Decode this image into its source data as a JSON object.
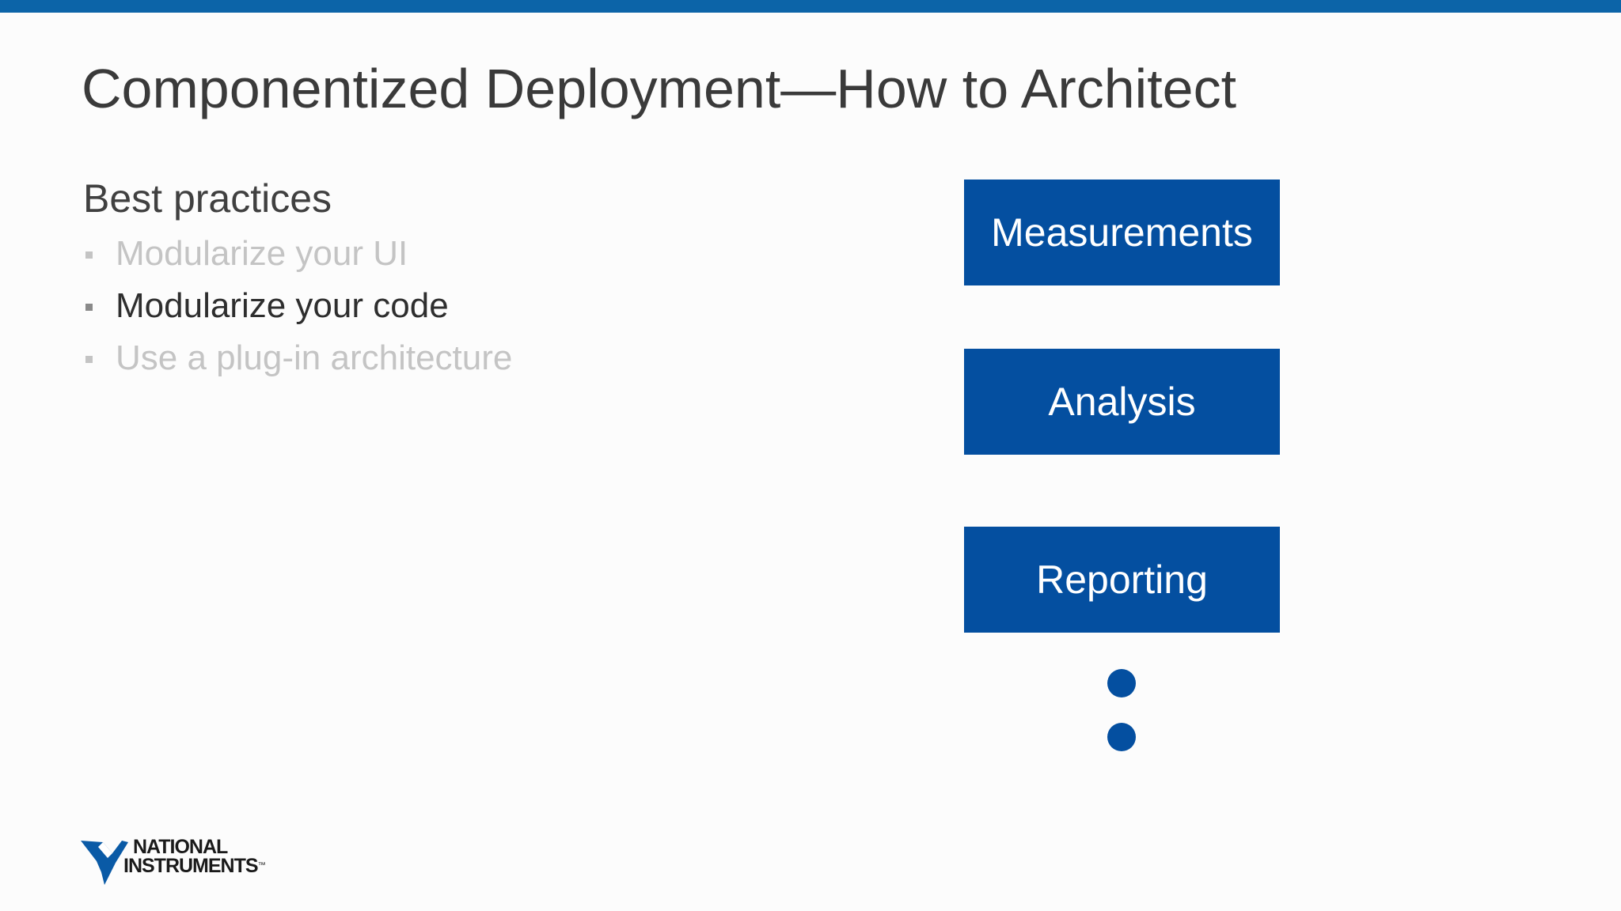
{
  "slide": {
    "title": "Componentized Deployment—How to Architect",
    "subheading": "Best practices",
    "bullets": [
      {
        "text": "Modularize your UI",
        "state": "dimmed"
      },
      {
        "text": "Modularize your code",
        "state": "active"
      },
      {
        "text": "Use a plug-in architecture",
        "state": "dimmed"
      }
    ]
  },
  "diagram": {
    "boxes": [
      "Measurements",
      "Analysis",
      "Reporting"
    ],
    "continuation": "vertical-ellipsis-dots"
  },
  "logo": {
    "line1": "NATIONAL",
    "line2": "INSTRUMENTS",
    "trademark": "™",
    "icon": "ni-eagle-logo-icon"
  },
  "colors": {
    "accent_bar": "#0c64a8",
    "box_fill": "#044fa0",
    "box_text": "#ffffff",
    "title_text": "#3a3a3a",
    "active_bullet": "#2e2e2e",
    "dimmed_bullet": "#c4c4c4"
  }
}
